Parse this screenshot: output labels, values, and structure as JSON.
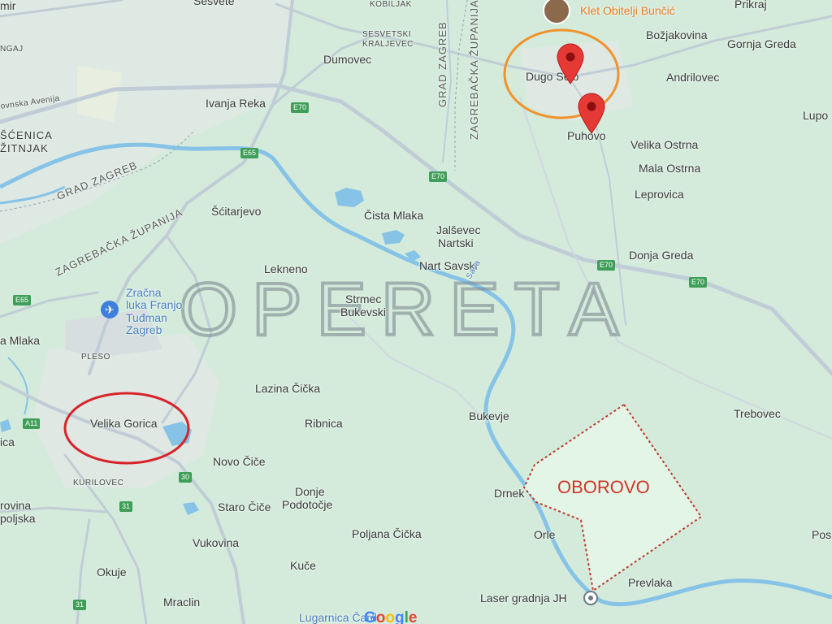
{
  "map": {
    "places": {
      "sesvete": "Sesvete",
      "kobiljak": "KOBILJAK",
      "klet": "Klet Obitelji Bunčić",
      "prikraj": "Prikraj",
      "bozjakovina": "Božjakovina",
      "gornja_greda": "Gornja Greda",
      "sesvetski_kraljevec_1": "SESVETSKI",
      "sesvetski_kraljevec_2": "KRALJEVEC",
      "dumovec": "Dumovec",
      "dugo_selo": "Dugo Selo",
      "andrilovec": "Andrilovec",
      "ivanja_reka": "Ivanja Reka",
      "lupo": "Lupo",
      "puhovo": "Puhovo",
      "velika_ostrna": "Velika Ostrna",
      "mala_ostrna": "Mala Ostrna",
      "leprovica": "Leprovica",
      "scitarjevo": "Šćitarjevo",
      "cista_mlaka": "Čista Mlaka",
      "jalsevec_1": "Jalševec",
      "jalsevec_2": "Nartski",
      "nart_savski": "Nart Savski",
      "donja_greda": "Donja Greda",
      "lekneno": "Lekneno",
      "strmec_1": "Strmec",
      "strmec_2": "Bukevski",
      "zracna_1": "Zračna",
      "zracna_2": "luka Franjo",
      "zracna_3": "Tuđman",
      "zracna_4": "Zagreb",
      "pleso": "PLESO",
      "mlaka": "a Mlaka",
      "lazina": "Lazina Čička",
      "velika_gorica": "Velika Gorica",
      "ribnica": "Ribnica",
      "bukevje": "Bukevje",
      "trebovec": "Trebovec",
      "novo_cice": "Novo Čiče",
      "kurilovec": "KURILOVEC",
      "donje_1": "Donje",
      "donje_2": "Podotočje",
      "drnek": "Drnek",
      "staro_cice": "Staro Čiče",
      "oborovo": "OBOROVO",
      "orle": "Orle",
      "poljana": "Poljana Čička",
      "vukovina": "Vukovina",
      "okuje": "Okuje",
      "kuce": "Kuče",
      "prevlaka": "Prevlaka",
      "laser": "Laser gradnja JH",
      "mraclin": "Mraclin",
      "lugarnica": "Lugarnica Čard",
      "pos": "Pos",
      "ica": "ica",
      "rovina_1": "rovina",
      "rovina_2": "poljska",
      "scenica_1": "ŠĆENICA",
      "scenica_2": "ŽITNJAK",
      "ngaj": "NGAJ",
      "mir": "mir",
      "avenija": "ovnska Avenija"
    },
    "regions": {
      "grad_zagreb_left": "GRAD ZAGREB",
      "zagrebacka_left": "ZAGREBAČKA ŽUPANIJA",
      "grad_zagreb_top": "GRAD ZAGREB",
      "zagrebacka_top": "ZAGREBAČKA ŽUPANIJA"
    },
    "shields": {
      "e70_a": "E70",
      "e70_b": "E70",
      "e70_c": "E70",
      "e70_d": "E70",
      "e65_a": "E65",
      "e65_b": "E65",
      "a11": "A11",
      "r30": "30",
      "r31_a": "31",
      "r31_b": "31"
    },
    "river": "Sava",
    "watermark": "OPERETA",
    "google_logo": "Google",
    "icons": {
      "pin_dugo_selo": "map-pin-icon",
      "pin_puhovo": "map-pin-icon",
      "airport": "airplane-icon",
      "laser_place": "place-icon",
      "klet_photo": "photo-place-icon"
    },
    "colors": {
      "background": "#d4ebdb",
      "road": "#c0cdd6",
      "water": "#86c3e6",
      "circle_orange": "#f0922b",
      "circle_red": "#d8232a",
      "oborovo_border": "#c0392b",
      "oborovo_fill": "#e2f5e7",
      "pin": "#e53935",
      "shield": "#3f9e58"
    }
  }
}
